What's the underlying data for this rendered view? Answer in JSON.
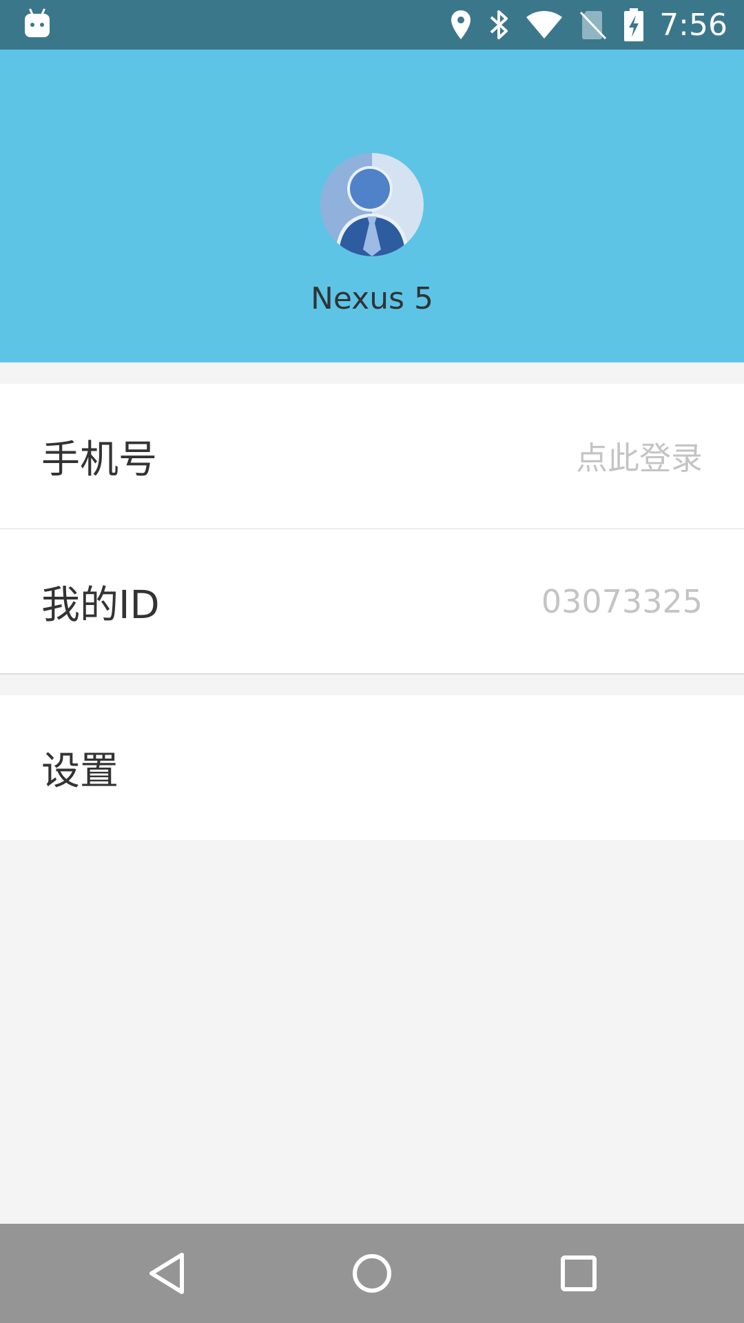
{
  "status_bar": {
    "time": "7:56",
    "icons": [
      "android-debug-icon",
      "location-icon",
      "bluetooth-icon",
      "wifi-icon",
      "no-sim-icon",
      "battery-charging-icon"
    ]
  },
  "header": {
    "device_name": "Nexus 5",
    "background_color": "#5ec4e6"
  },
  "rows": {
    "phone": {
      "label": "手机号",
      "value": "点此登录"
    },
    "id": {
      "label": "我的ID",
      "value": "03073325"
    },
    "settings": {
      "label": "设置"
    }
  },
  "nav_bar": {
    "buttons": [
      "back",
      "home",
      "recents"
    ]
  }
}
